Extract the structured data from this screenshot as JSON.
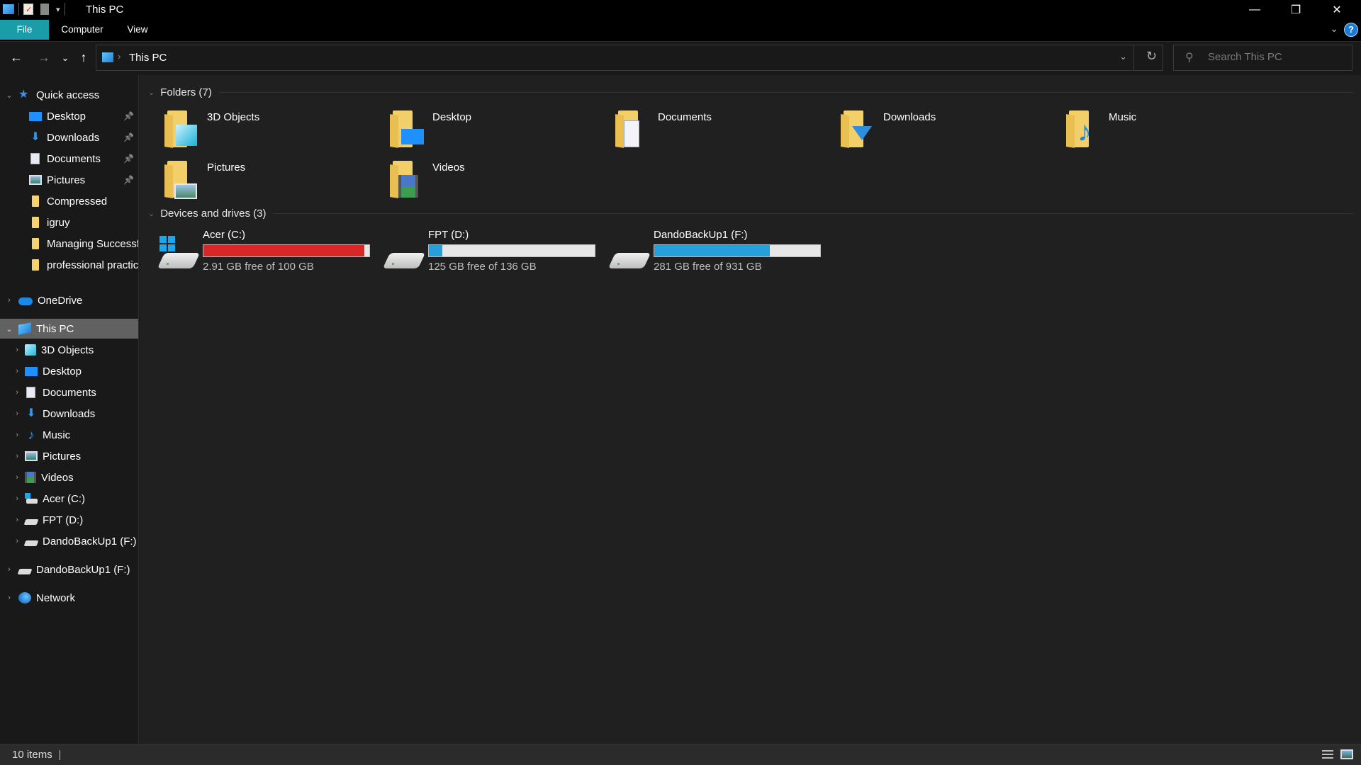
{
  "window": {
    "title": "This PC",
    "controls": {
      "minimize": "—",
      "restore": "❐",
      "close": "✕"
    }
  },
  "ribbon": {
    "tabs": [
      {
        "label": "File",
        "active": true
      },
      {
        "label": "Computer",
        "active": false
      },
      {
        "label": "View",
        "active": false
      }
    ],
    "help": "?",
    "collapse": "⌄"
  },
  "nav": {
    "back": "←",
    "forward": "→",
    "recent": "⌄",
    "up": "↑",
    "breadcrumb": [
      "This PC"
    ],
    "breadcrumb_sep": "›",
    "dropdown": "⌄",
    "refresh": "↻",
    "search_placeholder": "Search This PC",
    "search_value": ""
  },
  "sidebar": {
    "quick_access": {
      "label": "Quick access",
      "items": [
        {
          "label": "Desktop",
          "icon": "desktop-icon",
          "pinned": true
        },
        {
          "label": "Downloads",
          "icon": "downloads-icon",
          "pinned": true
        },
        {
          "label": "Documents",
          "icon": "documents-icon",
          "pinned": true
        },
        {
          "label": "Pictures",
          "icon": "pictures-icon",
          "pinned": true
        },
        {
          "label": "Compressed",
          "icon": "folder-icon",
          "pinned": false
        },
        {
          "label": "igruy",
          "icon": "folder-icon",
          "pinned": false
        },
        {
          "label": "Managing Successfu",
          "icon": "folder-icon",
          "pinned": false
        },
        {
          "label": "professional practic",
          "icon": "folder-icon",
          "pinned": false
        }
      ]
    },
    "onedrive": {
      "label": "OneDrive"
    },
    "this_pc": {
      "label": "This PC",
      "selected": true,
      "items": [
        {
          "label": "3D Objects",
          "icon": "3d-objects-icon"
        },
        {
          "label": "Desktop",
          "icon": "desktop-icon"
        },
        {
          "label": "Documents",
          "icon": "documents-icon"
        },
        {
          "label": "Downloads",
          "icon": "downloads-icon"
        },
        {
          "label": "Music",
          "icon": "music-icon"
        },
        {
          "label": "Pictures",
          "icon": "pictures-icon"
        },
        {
          "label": "Videos",
          "icon": "videos-icon"
        },
        {
          "label": "Acer (C:)",
          "icon": "windows-drive-icon"
        },
        {
          "label": "FPT (D:)",
          "icon": "drive-icon"
        },
        {
          "label": "DandoBackUp1 (F:)",
          "icon": "drive-icon"
        }
      ]
    },
    "external_drive": {
      "label": "DandoBackUp1 (F:)"
    },
    "network": {
      "label": "Network"
    }
  },
  "main": {
    "folders_header": "Folders (7)",
    "folders": [
      {
        "label": "3D Objects",
        "overlay": "3d-objects"
      },
      {
        "label": "Desktop",
        "overlay": "desktop"
      },
      {
        "label": "Documents",
        "overlay": "documents"
      },
      {
        "label": "Downloads",
        "overlay": "downloads"
      },
      {
        "label": "Music",
        "overlay": "music"
      },
      {
        "label": "Pictures",
        "overlay": "pictures"
      },
      {
        "label": "Videos",
        "overlay": "videos"
      }
    ],
    "drives_header": "Devices and drives (3)",
    "drives": [
      {
        "name": "Acer (C:)",
        "free_text": "2.91 GB free of 100 GB",
        "used_fraction": 0.971,
        "bar_color": "#da2626",
        "system": true
      },
      {
        "name": "FPT (D:)",
        "free_text": "125 GB free of 136 GB",
        "used_fraction": 0.081,
        "bar_color": "#26a0da",
        "system": false
      },
      {
        "name": "DandoBackUp1 (F:)",
        "free_text": "281 GB free of 931 GB",
        "used_fraction": 0.698,
        "bar_color": "#26a0da",
        "system": false
      }
    ]
  },
  "status": {
    "item_count": "10 items"
  },
  "colors": {
    "accent": "#1a9da8",
    "selection": "#616161",
    "drive_full": "#da2626",
    "drive_normal": "#26a0da"
  }
}
